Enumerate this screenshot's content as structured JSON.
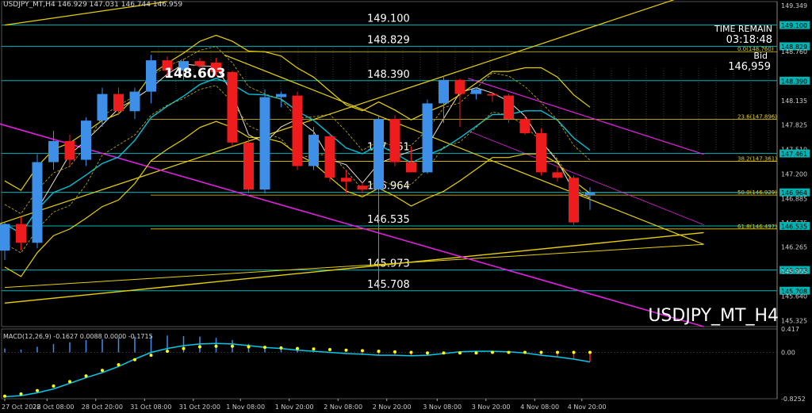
{
  "header": {
    "chart_info": "USDJPY_MT,H4  146.929 147.031 146.744 146.959",
    "macd_info": "MACD(12,26,9) -0.1627 0.0088 0.0000 -0.1715"
  },
  "time_remain": {
    "label": "TIME REMAIN",
    "value": "03:18:48"
  },
  "bid": {
    "label": "Bid",
    "value": "146,959"
  },
  "symbol_label": "USDJPY_MT_H4",
  "colors": {
    "background": "#000000",
    "bull": "#3d8fe8",
    "bear": "#ee1c1c",
    "cyan_line": "#00b4b4",
    "yellow_line": "#e8d000",
    "magenta_line": "#e020e0",
    "macd_signal": "#ffff00",
    "macd_line": "#00c8e8"
  },
  "chart_data": [
    {
      "type": "candlestick",
      "title": "USDJPY_MT,H4",
      "x_tick_labels": [
        "27 Oct 2022",
        "28 Oct 08:00",
        "28 Oct 20:00",
        "31 Oct 08:00",
        "31 Oct 20:00",
        "1 Nov 08:00",
        "1 Nov 20:00",
        "2 Nov 08:00",
        "2 Nov 20:00",
        "3 Nov 08:00",
        "3 Nov 20:00",
        "4 Nov 08:00",
        "4 Nov 20:00"
      ],
      "y_ticks": [
        "149.349",
        "149.100",
        "148.829",
        "148.760",
        "148.390",
        "148.135",
        "147.825",
        "147.510",
        "147.461",
        "147.200",
        "146.964",
        "146.885",
        "146.575",
        "146.535",
        "146.265",
        "145.973",
        "145.955",
        "145.708",
        "145.640",
        "145.325"
      ],
      "ylim": [
        145.25,
        149.4
      ],
      "candles": [
        {
          "o": 146.22,
          "h": 146.58,
          "l": 146.1,
          "c": 146.56
        },
        {
          "o": 146.56,
          "h": 146.65,
          "l": 146.22,
          "c": 146.32
        },
        {
          "o": 146.32,
          "h": 147.45,
          "l": 146.25,
          "c": 147.35
        },
        {
          "o": 147.35,
          "h": 147.75,
          "l": 147.25,
          "c": 147.62
        },
        {
          "o": 147.62,
          "h": 147.7,
          "l": 147.3,
          "c": 147.38
        },
        {
          "o": 147.38,
          "h": 147.92,
          "l": 147.3,
          "c": 147.88
        },
        {
          "o": 147.88,
          "h": 148.3,
          "l": 147.8,
          "c": 148.22
        },
        {
          "o": 148.22,
          "h": 148.3,
          "l": 147.95,
          "c": 148.0
        },
        {
          "o": 148.0,
          "h": 148.3,
          "l": 147.9,
          "c": 148.25
        },
        {
          "o": 148.25,
          "h": 148.72,
          "l": 148.1,
          "c": 148.65
        },
        {
          "o": 148.65,
          "h": 148.7,
          "l": 148.45,
          "c": 148.52
        },
        {
          "o": 148.52,
          "h": 148.67,
          "l": 148.4,
          "c": 148.64
        },
        {
          "o": 148.64,
          "h": 148.68,
          "l": 148.55,
          "c": 148.58
        },
        {
          "o": 148.62,
          "h": 148.68,
          "l": 148.45,
          "c": 148.5
        },
        {
          "o": 148.5,
          "h": 148.52,
          "l": 147.55,
          "c": 147.6
        },
        {
          "o": 147.6,
          "h": 147.65,
          "l": 146.95,
          "c": 147.0
        },
        {
          "o": 147.0,
          "h": 148.28,
          "l": 146.95,
          "c": 148.18
        },
        {
          "o": 148.18,
          "h": 148.25,
          "l": 148.05,
          "c": 148.22
        },
        {
          "o": 148.2,
          "h": 148.25,
          "l": 147.25,
          "c": 147.3
        },
        {
          "o": 147.3,
          "h": 147.8,
          "l": 147.25,
          "c": 147.7
        },
        {
          "o": 147.68,
          "h": 147.72,
          "l": 147.1,
          "c": 147.15
        },
        {
          "o": 147.15,
          "h": 147.25,
          "l": 146.95,
          "c": 147.1
        },
        {
          "o": 147.05,
          "h": 147.1,
          "l": 146.95,
          "c": 147.0
        },
        {
          "o": 147.0,
          "h": 147.95,
          "l": 145.72,
          "c": 147.9
        },
        {
          "o": 147.9,
          "h": 147.95,
          "l": 147.3,
          "c": 147.35
        },
        {
          "o": 147.35,
          "h": 147.55,
          "l": 147.25,
          "c": 147.22
        },
        {
          "o": 147.22,
          "h": 148.15,
          "l": 147.2,
          "c": 148.1
        },
        {
          "o": 148.1,
          "h": 148.45,
          "l": 147.85,
          "c": 148.4
        },
        {
          "o": 148.4,
          "h": 148.42,
          "l": 147.8,
          "c": 148.22
        },
        {
          "o": 148.22,
          "h": 148.3,
          "l": 148.15,
          "c": 148.28
        },
        {
          "o": 148.22,
          "h": 148.25,
          "l": 148.12,
          "c": 148.2
        },
        {
          "o": 148.2,
          "h": 148.22,
          "l": 147.85,
          "c": 147.9
        },
        {
          "o": 147.9,
          "h": 147.95,
          "l": 147.7,
          "c": 147.72
        },
        {
          "o": 147.72,
          "h": 147.78,
          "l": 147.18,
          "c": 147.22
        },
        {
          "o": 147.22,
          "h": 147.3,
          "l": 147.1,
          "c": 147.15
        },
        {
          "o": 147.15,
          "h": 147.18,
          "l": 146.55,
          "c": 146.58
        },
        {
          "o": 146.93,
          "h": 147.03,
          "l": 146.74,
          "c": 146.96
        }
      ],
      "horizontal_levels": [
        {
          "value": 149.1,
          "label": "149.100"
        },
        {
          "value": 148.829,
          "label": "148.829"
        },
        {
          "value": 148.39,
          "label": "148.390"
        },
        {
          "value": 147.461,
          "label": "147.461"
        },
        {
          "value": 146.964,
          "label": "146.964"
        },
        {
          "value": 146.535,
          "label": "146.535"
        },
        {
          "value": 145.973,
          "label": "145.973"
        },
        {
          "value": 145.708,
          "label": "145.708"
        }
      ],
      "fib_levels": [
        {
          "value": 148.76,
          "label": "0.0(148.760)"
        },
        {
          "value": 147.896,
          "label": "23.6(147.896)"
        },
        {
          "value": 147.361,
          "label": "38.2(147.361)"
        },
        {
          "value": 146.929,
          "label": "50.0(146.929)"
        },
        {
          "value": 146.497,
          "label": "61.8(146.497)"
        }
      ],
      "price_label": "148.603",
      "current_price": 146.959
    },
    {
      "type": "bar",
      "title": "MACD(12,26,9) -0.1627 0.0088 0.0000 -0.1715",
      "y_ticks": [
        "0.417",
        "0.00",
        "-0.8252"
      ],
      "ylim": [
        -0.8252,
        0.417
      ],
      "histogram": [
        0.07,
        0.05,
        0.1,
        0.15,
        0.18,
        0.22,
        0.24,
        0.26,
        0.28,
        0.3,
        0.3,
        0.29,
        0.28,
        0.26,
        0.22,
        0.15,
        0.1,
        0.08,
        0.05,
        0.02,
        0.0,
        -0.03,
        -0.05,
        -0.06,
        -0.05,
        -0.07,
        -0.06,
        -0.02,
        0.01,
        0.02,
        0.02,
        0.01,
        -0.01,
        -0.05,
        -0.08,
        -0.12,
        -0.17
      ],
      "signal": [
        -0.78,
        -0.74,
        -0.68,
        -0.6,
        -0.52,
        -0.42,
        -0.32,
        -0.22,
        -0.13,
        -0.05,
        0.02,
        0.07,
        0.1,
        0.11,
        0.11,
        0.1,
        0.09,
        0.08,
        0.07,
        0.06,
        0.05,
        0.04,
        0.03,
        0.02,
        0.01,
        0.0,
        -0.01,
        -0.01,
        -0.01,
        -0.01,
        0.0,
        0.0,
        0.0,
        0.0,
        0.0,
        0.0,
        0.0
      ],
      "macd_line": [
        -0.79,
        -0.77,
        -0.72,
        -0.65,
        -0.55,
        -0.45,
        -0.36,
        -0.25,
        -0.12,
        0.0,
        0.07,
        0.12,
        0.15,
        0.16,
        0.15,
        0.12,
        0.09,
        0.07,
        0.04,
        0.02,
        0.0,
        -0.02,
        -0.03,
        -0.05,
        -0.05,
        -0.06,
        -0.05,
        -0.02,
        0.01,
        0.02,
        0.02,
        0.01,
        -0.01,
        -0.05,
        -0.08,
        -0.12,
        -0.17
      ]
    }
  ]
}
